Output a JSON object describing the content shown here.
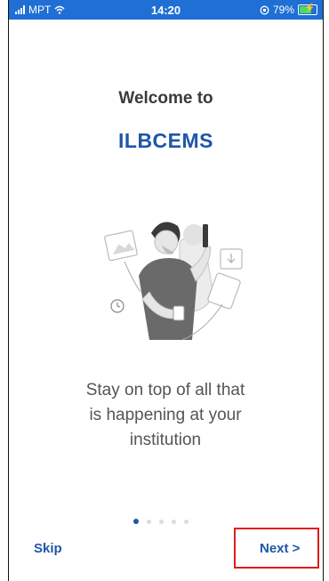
{
  "status_bar": {
    "carrier": "MPT",
    "time": "14:20",
    "battery": "79%"
  },
  "welcome": {
    "title": "Welcome to",
    "app_name": "ILBCEMS"
  },
  "illustration": {
    "icon": "person-with-phone-illustration"
  },
  "tagline": {
    "line1": "Stay on top of all that",
    "line2": "is happening at your",
    "line3": "institution"
  },
  "pager": {
    "total": 5,
    "current": 1
  },
  "buttons": {
    "skip": "Skip",
    "next": "Next >"
  },
  "colors": {
    "brand": "#1f56a8",
    "status_bar": "#1f6fd4",
    "highlight": "#e01b1b"
  }
}
